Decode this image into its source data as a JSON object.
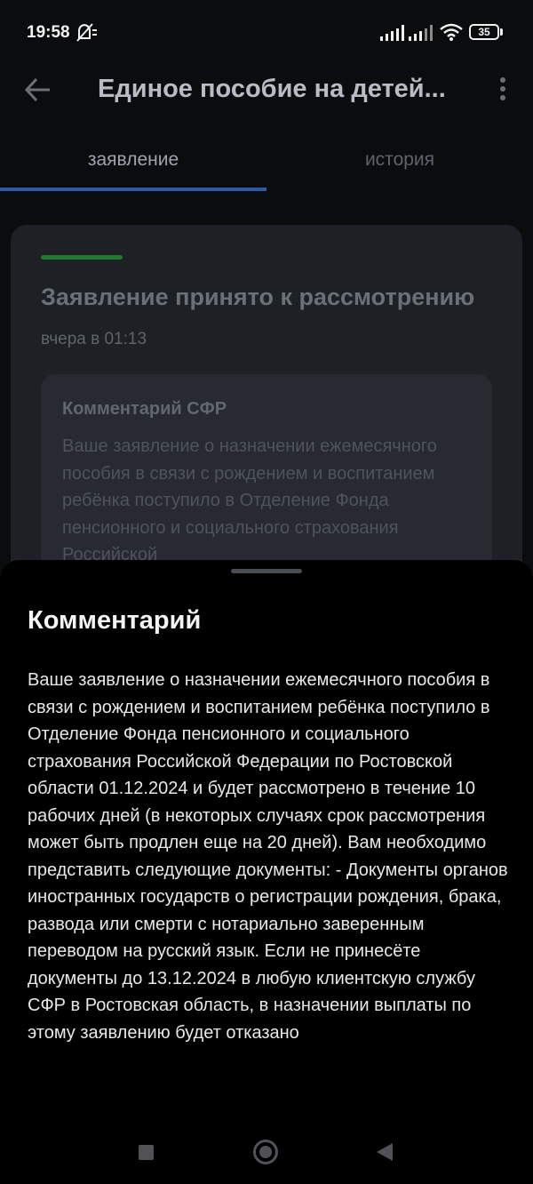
{
  "status_bar": {
    "time": "19:58",
    "battery": "35",
    "icons": [
      "mute-icon",
      "signal-icon",
      "signal-icon",
      "wifi-icon",
      "battery-icon"
    ]
  },
  "header": {
    "title": "Единое пособие на детей...",
    "back_icon": "arrow-left-icon",
    "menu_icon": "more-vertical-icon"
  },
  "tabs": [
    {
      "label": "заявление",
      "active": true
    },
    {
      "label": "история",
      "active": false
    }
  ],
  "colors": {
    "accent": "#2b5ba8",
    "status_green": "#1f7a2f"
  },
  "card": {
    "status_title": "Заявление принято к рассмотрению",
    "date": "вчера в 01:13",
    "comment_title": "Комментарий СФР",
    "comment_preview": "Ваше заявление о назначении ежемесячного пособия в связи с рождением и воспитанием ребёнка поступило в Отделение Фонда пенсионного и социального страхования Российской"
  },
  "sheet": {
    "title": "Комментарий",
    "text": "Ваше заявление о назначении ежемесячного пособия в связи с рождением и воспитанием ребёнка поступило в Отделение Фонда пенсионного и социального страхования Российской Федерации по Ростовской области 01.12.2024 и будет рассмотрено в течение 10 рабочих дней (в некоторых случаях срок рассмотрения может быть продлен еще на 20 дней). Вам необходимо представить следующие документы: - Документы органов иностранных государств о регистрации рождения, брака, развода или смерти с нотариально заверенным переводом на русский язык. Если не принесёте документы до 13.12.2024 в любую клиентскую службу СФР в Ростовская область, в назначении выплаты по этому заявлению будет отказано"
  },
  "nav_bar": {
    "icons": [
      "recents-square-icon",
      "home-circle-icon",
      "back-triangle-icon"
    ]
  }
}
